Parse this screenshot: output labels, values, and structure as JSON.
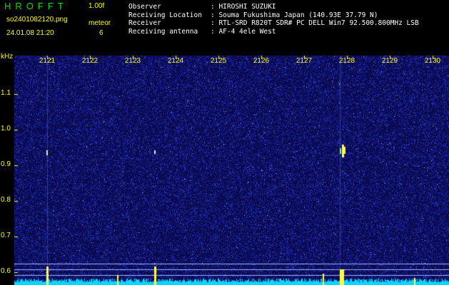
{
  "header": {
    "app_title": "HROFFT",
    "version": "1.00f",
    "filename": "so2401082120.png",
    "mode": "meteor",
    "datetime": "24.01.08 21:20",
    "count": "6",
    "info": [
      {
        "label": "Observer",
        "value": ": HIROSHI SUZUKI"
      },
      {
        "label": "Receiving Location",
        "value": ": Souma Fukushima Japan (140.93E 37.79 N)"
      },
      {
        "label": "Receiver",
        "value": ": RTL-SRD R820T SDR# PC DELL Win7 92.500.800MHz LSB"
      },
      {
        "label": "Receiving antenna",
        "value": ": AF-4 4ele West"
      }
    ]
  },
  "spectrogram": {
    "y_unit": "kHz",
    "x_ticks": [
      "2121",
      "2122",
      "2123",
      "2124",
      "2125",
      "2126",
      "2127",
      "2128",
      "2129",
      "2130"
    ],
    "y_ticks": [
      "1.1",
      "1.0",
      "0.9",
      "0.8",
      "0.7",
      "0.6"
    ],
    "colors": {
      "background": "#0a0a52",
      "noise": "#2a3fd0",
      "baseline": "#00d8ff",
      "burst": "#ffff40"
    }
  }
}
